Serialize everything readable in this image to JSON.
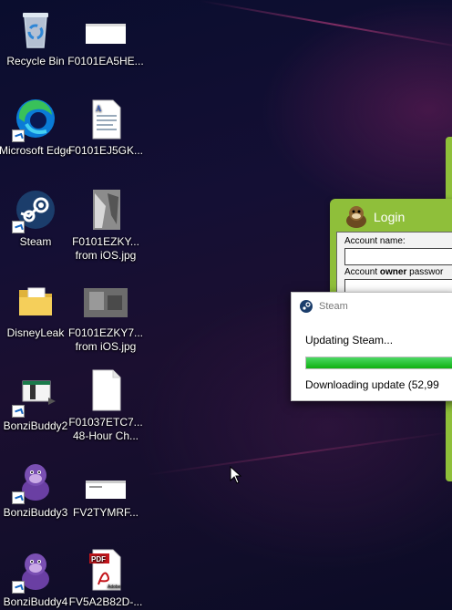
{
  "desktop_icons": [
    {
      "label": "Recycle Bin",
      "icon": "recycle-bin-icon"
    },
    {
      "label": "F0101EA5HE...",
      "icon": "image-file-icon"
    },
    {
      "label": "Microsoft Edge",
      "icon": "edge-icon"
    },
    {
      "label": "F0101EJ5GK...",
      "icon": "document-file-icon"
    },
    {
      "label": "Steam",
      "icon": "steam-icon"
    },
    {
      "label": "F0101EZKY... from iOS.jpg",
      "icon": "photo-file-icon"
    },
    {
      "label": "DisneyLeak",
      "icon": "folder-icon"
    },
    {
      "label": "F0101EZKY7... from iOS.jpg",
      "icon": "photo-file-icon"
    },
    {
      "label": "BonziBuddy2",
      "icon": "app-shortcut-icon"
    },
    {
      "label": "F01037ETC7... 48-Hour Ch...",
      "icon": "blank-file-icon"
    },
    {
      "label": "BonziBuddy3",
      "icon": "bonzi-gorilla-icon"
    },
    {
      "label": "FV2TYMRF...",
      "icon": "image-file-icon"
    },
    {
      "label": "BonziBuddy4",
      "icon": "bonzi-gorilla-icon"
    },
    {
      "label": "FV5A2B82D-...",
      "icon": "pdf-file-icon"
    }
  ],
  "login_window": {
    "title": "Login",
    "account_name_label": "Account name:",
    "password_label_prefix": "Account ",
    "password_label_bold": "owner",
    "password_label_suffix": " passwor"
  },
  "steam_updater": {
    "title": "Steam",
    "status": "Updating Steam...",
    "progress": 1.0,
    "download_text": "Downloading update (52,99"
  },
  "colors": {
    "bonzi_green": "#8fbf3a",
    "progress_green": "#1ec41e",
    "bonzi_purple": "#7a4fb3",
    "edge_blue": "#0a7bd6",
    "steam_blue": "#1b3d6b",
    "pdf_red": "#c4161c"
  }
}
